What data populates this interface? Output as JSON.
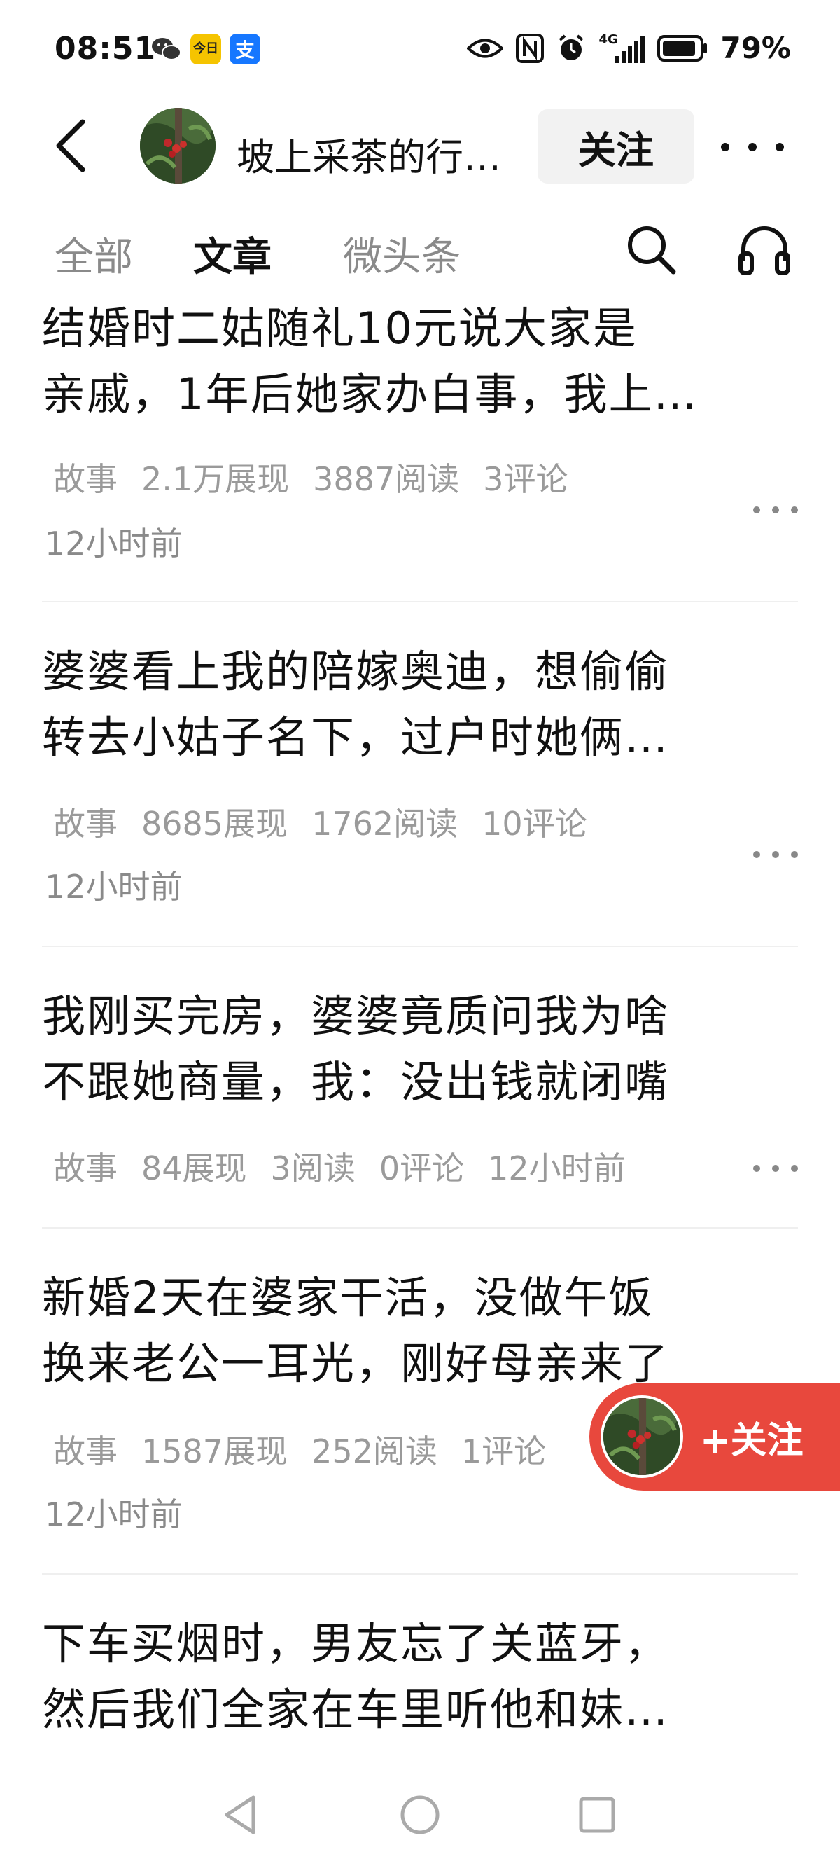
{
  "status_bar": {
    "time": "08:51",
    "battery": "79%",
    "network": "4G",
    "icons": [
      "wechat-icon",
      "toutiao-app-icon",
      "alipay-icon",
      "eye-icon",
      "nfc-icon",
      "alarm-icon",
      "signal-icon",
      "battery-icon"
    ],
    "toutiao_label": "今日",
    "alipay_label": "支"
  },
  "header": {
    "title": "坡上采茶的行…",
    "follow_label": "关注"
  },
  "tabs": [
    {
      "label": "全部",
      "active": false
    },
    {
      "label": "文章",
      "active": true
    },
    {
      "label": "微头条",
      "active": false
    }
  ],
  "articles": [
    {
      "title_lines": [
        "结婚时二姑随礼10元说大家是",
        "亲戚，1年后她家办白事，我上…"
      ],
      "category": "故事",
      "impressions": "2.1万展现",
      "reads": "3887阅读",
      "comments": "3评论",
      "time": "12小时前"
    },
    {
      "title_lines": [
        "婆婆看上我的陪嫁奥迪，想偷偷",
        "转去小姑子名下，过户时她俩…"
      ],
      "category": "故事",
      "impressions": "8685展现",
      "reads": "1762阅读",
      "comments": "10评论",
      "time": "12小时前"
    },
    {
      "title_lines": [
        "我刚买完房，婆婆竟质问我为啥",
        "不跟她商量，我：没出钱就闭嘴"
      ],
      "category": "故事",
      "impressions": "84展现",
      "reads": "3阅读",
      "comments": "0评论",
      "time": "12小时前"
    },
    {
      "title_lines": [
        "新婚2天在婆家干活，没做午饭",
        "换来老公一耳光，刚好母亲来了"
      ],
      "category": "故事",
      "impressions": "1587展现",
      "reads": "252阅读",
      "comments": "1评论",
      "time": "12小时前"
    },
    {
      "title_lines": [
        "下车买烟时，男友忘了关蓝牙，",
        "然后我们全家在车里听他和妹…"
      ]
    }
  ],
  "floating_follow": {
    "label": "+关注"
  },
  "accent_color": "#e8483d"
}
